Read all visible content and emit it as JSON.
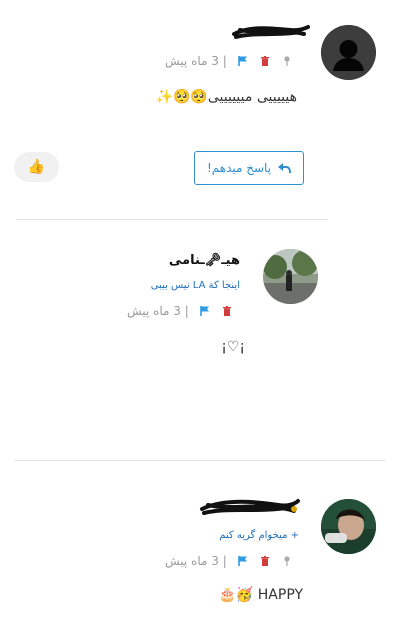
{
  "comments": [
    {
      "username": "",
      "time": "| 3 ماه پیش",
      "text": "هیییییی مییییییی🥺🥺✨",
      "reply_label": "پاسخ میدهم!",
      "like_emoji": "👍"
    },
    {
      "username": "هیـ🗝ـنامی",
      "bio": "اینجا کة LA نیس بیبی",
      "time": "| 3 ماه پیش",
      "text": "¡♡¡"
    },
    {
      "username": "",
      "bio": "+ میخوام گریه کنم",
      "time": "| 3 ماه پیش",
      "text": "HAPPY 🥳🎂"
    }
  ],
  "icons": {
    "pin": "pin-icon",
    "delete": "trash-icon",
    "flag": "flag-icon",
    "reply": "reply-arrow-icon"
  },
  "colors": {
    "accent": "#2f8fd1",
    "delete": "#d33c3c",
    "flag": "#2f9be0"
  }
}
